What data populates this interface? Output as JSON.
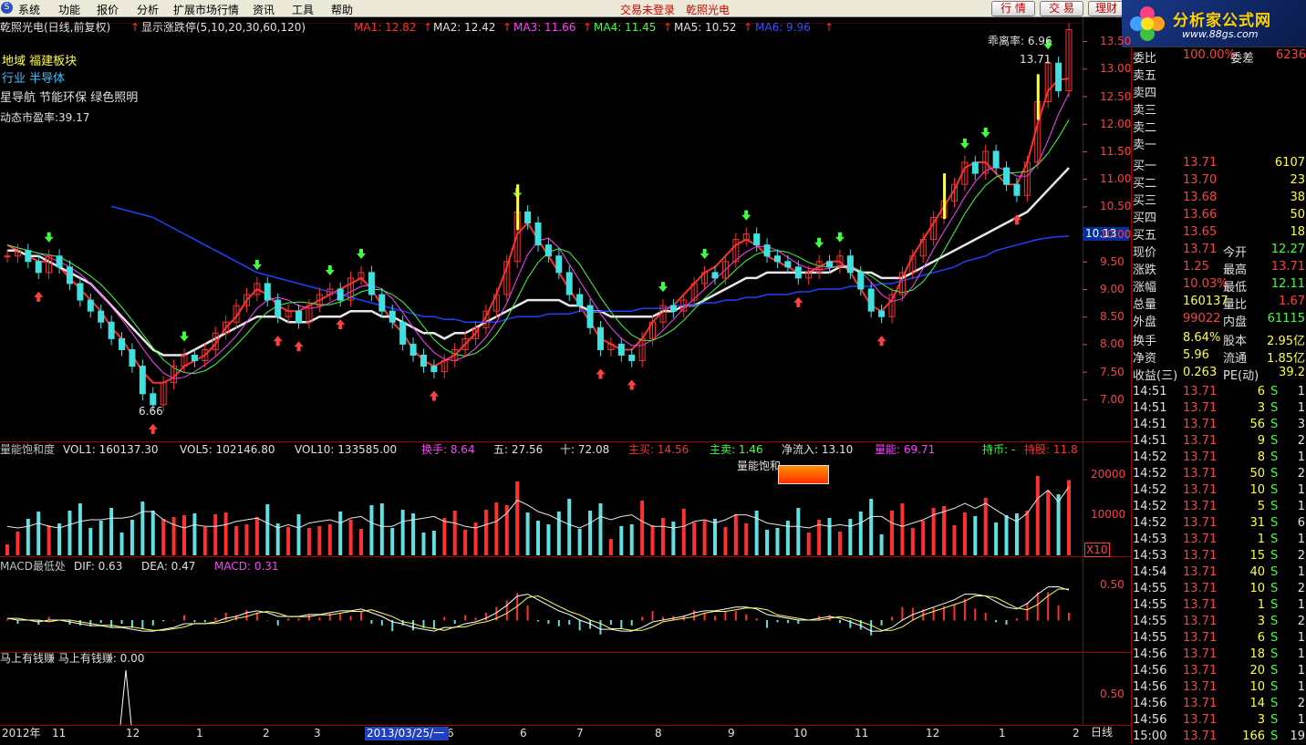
{
  "menu": {
    "items": [
      "系统",
      "功能",
      "报价",
      "分析",
      "扩展市场行情",
      "资讯",
      "工具",
      "帮助"
    ],
    "warn1": "交易未登录",
    "warn2": "乾照光电",
    "btn_quote": "行 情",
    "btn_trade": "交 易",
    "btn_finance": "理财"
  },
  "brand": {
    "name": "分析家公式网",
    "url": "www.88gs.com"
  },
  "title": {
    "stock": "乾照光电(日线,前复权)",
    "toggle": "显示涨跌停(5,10,20,30,60,120)"
  },
  "ma": [
    {
      "label": "MA1: 12.82",
      "color": "#ff3030"
    },
    {
      "label": "MA2: 12.42",
      "color": "#e0e0e0"
    },
    {
      "label": "MA3: 11.66",
      "color": "#ff40ff"
    },
    {
      "label": "MA4: 11.45",
      "color": "#40ff40"
    },
    {
      "label": "MA5: 10.52",
      "color": "#e0e0e0"
    },
    {
      "label": "MA6: 9.96",
      "color": "#3050ff"
    }
  ],
  "info": {
    "region": "地域  福建板块",
    "industry": "行业    半导体",
    "concepts": "星导航 节能环保 绿色照明",
    "pe": "动态市盈率:39.17",
    "deviation": "乖离率: 6.96",
    "high_mark": "13.71",
    "low_mark": "6.66",
    "price_tag": "10.13"
  },
  "price_axis": [
    "13.50",
    "13.00",
    "12.50",
    "12.00",
    "11.50",
    "11.00",
    "10.50",
    "10.00",
    "9.50",
    "9.00",
    "8.50",
    "8.00",
    "7.50",
    "7.00"
  ],
  "vol_header": [
    {
      "t": "量能饱和度",
      "c": "#c0c0c0"
    },
    {
      "t": "VOL1: 160137.30",
      "c": "#e0e0e0"
    },
    {
      "t": "VOL5: 102146.80",
      "c": "#e0e0e0"
    },
    {
      "t": "VOL10: 133585.00",
      "c": "#e0e0e0"
    },
    {
      "t": "换手: 8.64",
      "c": "#ff40ff"
    },
    {
      "t": "五: 27.56",
      "c": "#e0e0e0"
    },
    {
      "t": "十: 72.08",
      "c": "#e0e0e0"
    },
    {
      "t": "主买: 14.56",
      "c": "#ff3030"
    },
    {
      "t": "主卖: 1.46",
      "c": "#40ff40"
    },
    {
      "t": "净流入: 13.10",
      "c": "#e0e0e0"
    },
    {
      "t": "量能: 69.71",
      "c": "#ff40ff"
    },
    {
      "t": "持币: -",
      "c": "#40ff40"
    },
    {
      "t": "持股: 11.8",
      "c": "#ff3030"
    }
  ],
  "vol_tag": "量能饱和",
  "vol_axis": [
    "20000",
    "10000"
  ],
  "vol_unit": "X10",
  "macd_header": [
    {
      "t": "MACD最低处",
      "c": "#c0c0c0"
    },
    {
      "t": "DIF: 0.63",
      "c": "#e0e0e0"
    },
    {
      "t": "DEA: 0.47",
      "c": "#e0e0e0"
    },
    {
      "t": "MACD: 0.31",
      "c": "#ff40ff"
    }
  ],
  "macd_axis": [
    "0.50"
  ],
  "earn_header": "马上有钱赚  马上有钱赚: 0.00",
  "earn_axis": [
    "0.50"
  ],
  "date_axis": [
    {
      "t": "2012年",
      "x": 2
    },
    {
      "t": "11",
      "x": 57
    },
    {
      "t": "12",
      "x": 138
    },
    {
      "t": "1",
      "x": 215
    },
    {
      "t": "2",
      "x": 288
    },
    {
      "t": "3",
      "x": 344
    },
    {
      "t": "6",
      "x": 490
    },
    {
      "t": "6",
      "x": 570
    },
    {
      "t": "7",
      "x": 632
    },
    {
      "t": "8",
      "x": 718
    },
    {
      "t": "9",
      "x": 798
    },
    {
      "t": "10",
      "x": 870
    },
    {
      "t": "11",
      "x": 937
    },
    {
      "t": "12",
      "x": 1015
    },
    {
      "t": "1",
      "x": 1095
    },
    {
      "t": "2",
      "x": 1176
    }
  ],
  "date_selected": "2013/03/25/一",
  "period": "日线",
  "panel": {
    "top_label": "委比",
    "top_val": "100.00%",
    "top_label2": "委差",
    "top_val2": "6236",
    "sells": [
      "卖五",
      "卖四",
      "卖三",
      "卖二",
      "卖一"
    ],
    "buys": [
      {
        "l": "买一",
        "p": "13.71",
        "v": "6107"
      },
      {
        "l": "买二",
        "p": "13.70",
        "v": "23"
      },
      {
        "l": "买三",
        "p": "13.68",
        "v": "38"
      },
      {
        "l": "买四",
        "p": "13.66",
        "v": "50"
      },
      {
        "l": "买五",
        "p": "13.65",
        "v": "18"
      }
    ],
    "stats": [
      {
        "a": "现价",
        "av": "13.71",
        "ac": "#ff4040",
        "b": "今开",
        "bv": "12.27",
        "bc": "#40ff40"
      },
      {
        "a": "涨跌",
        "av": "1.25",
        "ac": "#ff4040",
        "b": "最高",
        "bv": "13.71",
        "bc": "#ff4040"
      },
      {
        "a": "涨幅",
        "av": "10.03%",
        "ac": "#ff4040",
        "b": "最低",
        "bv": "12.11",
        "bc": "#40ff40"
      },
      {
        "a": "总量",
        "av": "160137",
        "ac": "#ffff40",
        "b": "量比",
        "bv": "1.67",
        "bc": "#ff4040"
      },
      {
        "a": "外盘",
        "av": "99022",
        "ac": "#ff4040",
        "b": "内盘",
        "bv": "61115",
        "bc": "#40ff40"
      }
    ],
    "fin": [
      {
        "a": "换手",
        "av": "8.64%",
        "b": "股本",
        "bv": "2.95亿"
      },
      {
        "a": "净资",
        "av": "5.96",
        "b": "流通",
        "bv": "1.85亿"
      },
      {
        "a": "收益(三)",
        "av": "0.263",
        "b": "PE(动)",
        "bv": "39.2"
      }
    ],
    "ticks": [
      {
        "t": "14:51",
        "p": "13.71",
        "v": "6",
        "s": "S",
        "n": "1"
      },
      {
        "t": "14:51",
        "p": "13.71",
        "v": "3",
        "s": "S",
        "n": "1"
      },
      {
        "t": "14:51",
        "p": "13.71",
        "v": "56",
        "s": "S",
        "n": "3"
      },
      {
        "t": "14:51",
        "p": "13.71",
        "v": "9",
        "s": "S",
        "n": "2"
      },
      {
        "t": "14:52",
        "p": "13.71",
        "v": "8",
        "s": "S",
        "n": "1"
      },
      {
        "t": "14:52",
        "p": "13.71",
        "v": "50",
        "s": "S",
        "n": "2"
      },
      {
        "t": "14:52",
        "p": "13.71",
        "v": "10",
        "s": "S",
        "n": "1"
      },
      {
        "t": "14:52",
        "p": "13.71",
        "v": "5",
        "s": "S",
        "n": "1"
      },
      {
        "t": "14:52",
        "p": "13.71",
        "v": "31",
        "s": "S",
        "n": "6"
      },
      {
        "t": "14:53",
        "p": "13.71",
        "v": "1",
        "s": "S",
        "n": "1"
      },
      {
        "t": "14:53",
        "p": "13.71",
        "v": "15",
        "s": "S",
        "n": "2"
      },
      {
        "t": "14:54",
        "p": "13.71",
        "v": "40",
        "s": "S",
        "n": "1"
      },
      {
        "t": "14:55",
        "p": "13.71",
        "v": "10",
        "s": "S",
        "n": "2"
      },
      {
        "t": "14:55",
        "p": "13.71",
        "v": "1",
        "s": "S",
        "n": "1"
      },
      {
        "t": "14:55",
        "p": "13.71",
        "v": "3",
        "s": "S",
        "n": "2"
      },
      {
        "t": "14:55",
        "p": "13.71",
        "v": "6",
        "s": "S",
        "n": "1"
      },
      {
        "t": "14:56",
        "p": "13.71",
        "v": "18",
        "s": "S",
        "n": "1"
      },
      {
        "t": "14:56",
        "p": "13.71",
        "v": "20",
        "s": "S",
        "n": "1"
      },
      {
        "t": "14:56",
        "p": "13.71",
        "v": "10",
        "s": "S",
        "n": "1"
      },
      {
        "t": "14:56",
        "p": "13.71",
        "v": "14",
        "s": "S",
        "n": "2"
      },
      {
        "t": "14:56",
        "p": "13.71",
        "v": "3",
        "s": "S",
        "n": "1"
      },
      {
        "t": "15:00",
        "p": "13.71",
        "v": "166",
        "s": "S",
        "n": "19"
      }
    ]
  },
  "chart_data": {
    "type": "line",
    "title": "",
    "price_range": [
      6.6,
      13.75
    ],
    "close": [
      9.6,
      9.7,
      9.5,
      9.3,
      9.6,
      9.4,
      9.1,
      8.8,
      8.6,
      8.4,
      8.1,
      7.9,
      7.6,
      7.1,
      6.9,
      7.3,
      7.6,
      7.8,
      7.7,
      7.9,
      8.2,
      8.4,
      8.7,
      8.9,
      9.1,
      8.8,
      8.5,
      8.6,
      8.4,
      8.7,
      8.9,
      9.0,
      8.8,
      9.2,
      9.3,
      8.9,
      8.6,
      8.4,
      8.0,
      7.8,
      7.6,
      7.5,
      7.7,
      7.9,
      8.1,
      8.3,
      8.6,
      8.9,
      9.5,
      10.4,
      10.2,
      9.8,
      9.6,
      9.3,
      8.9,
      8.7,
      8.3,
      7.9,
      8.0,
      7.8,
      7.7,
      8.1,
      8.4,
      8.7,
      8.6,
      8.8,
      9.1,
      9.3,
      9.2,
      9.5,
      9.9,
      10.0,
      9.8,
      9.6,
      9.5,
      9.4,
      9.2,
      9.3,
      9.5,
      9.4,
      9.6,
      9.3,
      9.0,
      8.6,
      8.5,
      8.9,
      9.3,
      9.6,
      9.9,
      10.3,
      10.6,
      10.9,
      11.3,
      11.1,
      11.5,
      11.2,
      10.9,
      10.7,
      11.3,
      12.4,
      13.1,
      12.6,
      13.71
    ],
    "series": [
      {
        "name": "MA1",
        "values": [
          9.8,
          9.7,
          9.6,
          9.5,
          9.5,
          9.4,
          9.2,
          9.0,
          8.8,
          8.6,
          8.3,
          8.1,
          7.8,
          7.5,
          7.3,
          7.3,
          7.4,
          7.6,
          7.7,
          7.8,
          8.0,
          8.3,
          8.5,
          8.8,
          9.0,
          8.9,
          8.7,
          8.6,
          8.6,
          8.7,
          8.8,
          8.9,
          9.0,
          9.1,
          9.2,
          9.0,
          8.7,
          8.4,
          8.2,
          7.9,
          7.7,
          7.6,
          7.7,
          7.8,
          8.0,
          8.2,
          8.5,
          8.9,
          9.4,
          10.0,
          10.2,
          9.9,
          9.6,
          9.3,
          9.0,
          8.7,
          8.4,
          8.1,
          8.0,
          7.9,
          7.9,
          8.1,
          8.4,
          8.6,
          8.7,
          8.9,
          9.1,
          9.3,
          9.4,
          9.6,
          9.8,
          9.9,
          9.8,
          9.6,
          9.5,
          9.4,
          9.3,
          9.3,
          9.4,
          9.5,
          9.5,
          9.3,
          9.0,
          8.7,
          8.6,
          8.8,
          9.2,
          9.6,
          9.9,
          10.2,
          10.5,
          10.8,
          11.2,
          11.3,
          11.3,
          11.1,
          10.9,
          10.9,
          11.3,
          12.0,
          12.6,
          12.8,
          12.82
        ]
      },
      {
        "name": "MA5",
        "values": [
          9.7,
          9.7,
          9.6,
          9.6,
          9.5,
          9.4,
          9.3,
          9.2,
          9.1,
          8.9,
          8.7,
          8.5,
          8.3,
          8.1,
          7.9,
          7.8,
          7.8,
          7.8,
          7.9,
          8.0,
          8.1,
          8.2,
          8.3,
          8.4,
          8.5,
          8.5,
          8.5,
          8.4,
          8.4,
          8.4,
          8.5,
          8.5,
          8.5,
          8.6,
          8.6,
          8.6,
          8.5,
          8.5,
          8.4,
          8.3,
          8.2,
          8.2,
          8.1,
          8.2,
          8.2,
          8.3,
          8.4,
          8.5,
          8.6,
          8.7,
          8.8,
          8.8,
          8.8,
          8.8,
          8.7,
          8.7,
          8.6,
          8.6,
          8.5,
          8.5,
          8.5,
          8.5,
          8.5,
          8.6,
          8.6,
          8.7,
          8.7,
          8.8,
          8.9,
          9.0,
          9.1,
          9.2,
          9.2,
          9.3,
          9.3,
          9.3,
          9.3,
          9.3,
          9.3,
          9.3,
          9.4,
          9.4,
          9.3,
          9.3,
          9.2,
          9.2,
          9.2,
          9.3,
          9.4,
          9.5,
          9.6,
          9.7,
          9.8,
          9.9,
          10.0,
          10.1,
          10.2,
          10.3,
          10.4,
          10.6,
          10.8,
          11.0,
          11.2
        ]
      },
      {
        "name": "MA6",
        "values": [
          null,
          null,
          null,
          null,
          null,
          null,
          null,
          null,
          null,
          null,
          10.5,
          10.45,
          10.4,
          10.35,
          10.3,
          10.2,
          10.1,
          10.0,
          9.9,
          9.8,
          9.7,
          9.6,
          9.5,
          9.4,
          9.3,
          9.25,
          9.2,
          9.15,
          9.1,
          9.05,
          9.0,
          8.95,
          8.9,
          8.85,
          8.8,
          8.75,
          8.7,
          8.65,
          8.6,
          8.55,
          8.5,
          8.5,
          8.45,
          8.45,
          8.4,
          8.4,
          8.4,
          8.4,
          8.45,
          8.5,
          8.5,
          8.5,
          8.55,
          8.55,
          8.55,
          8.6,
          8.6,
          8.6,
          8.6,
          8.6,
          8.6,
          8.65,
          8.65,
          8.65,
          8.7,
          8.7,
          8.7,
          8.75,
          8.75,
          8.8,
          8.8,
          8.85,
          8.85,
          8.9,
          8.9,
          8.9,
          8.95,
          8.95,
          9.0,
          9.0,
          9.0,
          9.05,
          9.05,
          9.05,
          9.1,
          9.1,
          9.15,
          9.2,
          9.25,
          9.3,
          9.35,
          9.4,
          9.5,
          9.55,
          9.6,
          9.7,
          9.75,
          9.8,
          9.85,
          9.9,
          9.93,
          9.95,
          9.96
        ]
      }
    ]
  }
}
